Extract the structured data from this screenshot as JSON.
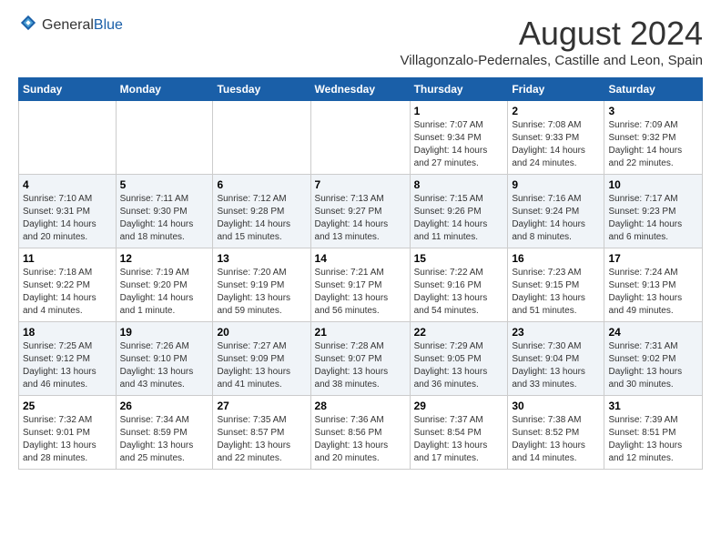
{
  "header": {
    "logo_general": "General",
    "logo_blue": "Blue",
    "month_year": "August 2024",
    "location": "Villagonzalo-Pedernales, Castille and Leon, Spain"
  },
  "weekdays": [
    "Sunday",
    "Monday",
    "Tuesday",
    "Wednesday",
    "Thursday",
    "Friday",
    "Saturday"
  ],
  "weeks": [
    [
      {
        "day": "",
        "sunrise": "",
        "sunset": "",
        "daylight": ""
      },
      {
        "day": "",
        "sunrise": "",
        "sunset": "",
        "daylight": ""
      },
      {
        "day": "",
        "sunrise": "",
        "sunset": "",
        "daylight": ""
      },
      {
        "day": "",
        "sunrise": "",
        "sunset": "",
        "daylight": ""
      },
      {
        "day": "1",
        "sunrise": "Sunrise: 7:07 AM",
        "sunset": "Sunset: 9:34 PM",
        "daylight": "Daylight: 14 hours and 27 minutes."
      },
      {
        "day": "2",
        "sunrise": "Sunrise: 7:08 AM",
        "sunset": "Sunset: 9:33 PM",
        "daylight": "Daylight: 14 hours and 24 minutes."
      },
      {
        "day": "3",
        "sunrise": "Sunrise: 7:09 AM",
        "sunset": "Sunset: 9:32 PM",
        "daylight": "Daylight: 14 hours and 22 minutes."
      }
    ],
    [
      {
        "day": "4",
        "sunrise": "Sunrise: 7:10 AM",
        "sunset": "Sunset: 9:31 PM",
        "daylight": "Daylight: 14 hours and 20 minutes."
      },
      {
        "day": "5",
        "sunrise": "Sunrise: 7:11 AM",
        "sunset": "Sunset: 9:30 PM",
        "daylight": "Daylight: 14 hours and 18 minutes."
      },
      {
        "day": "6",
        "sunrise": "Sunrise: 7:12 AM",
        "sunset": "Sunset: 9:28 PM",
        "daylight": "Daylight: 14 hours and 15 minutes."
      },
      {
        "day": "7",
        "sunrise": "Sunrise: 7:13 AM",
        "sunset": "Sunset: 9:27 PM",
        "daylight": "Daylight: 14 hours and 13 minutes."
      },
      {
        "day": "8",
        "sunrise": "Sunrise: 7:15 AM",
        "sunset": "Sunset: 9:26 PM",
        "daylight": "Daylight: 14 hours and 11 minutes."
      },
      {
        "day": "9",
        "sunrise": "Sunrise: 7:16 AM",
        "sunset": "Sunset: 9:24 PM",
        "daylight": "Daylight: 14 hours and 8 minutes."
      },
      {
        "day": "10",
        "sunrise": "Sunrise: 7:17 AM",
        "sunset": "Sunset: 9:23 PM",
        "daylight": "Daylight: 14 hours and 6 minutes."
      }
    ],
    [
      {
        "day": "11",
        "sunrise": "Sunrise: 7:18 AM",
        "sunset": "Sunset: 9:22 PM",
        "daylight": "Daylight: 14 hours and 4 minutes."
      },
      {
        "day": "12",
        "sunrise": "Sunrise: 7:19 AM",
        "sunset": "Sunset: 9:20 PM",
        "daylight": "Daylight: 14 hours and 1 minute."
      },
      {
        "day": "13",
        "sunrise": "Sunrise: 7:20 AM",
        "sunset": "Sunset: 9:19 PM",
        "daylight": "Daylight: 13 hours and 59 minutes."
      },
      {
        "day": "14",
        "sunrise": "Sunrise: 7:21 AM",
        "sunset": "Sunset: 9:17 PM",
        "daylight": "Daylight: 13 hours and 56 minutes."
      },
      {
        "day": "15",
        "sunrise": "Sunrise: 7:22 AM",
        "sunset": "Sunset: 9:16 PM",
        "daylight": "Daylight: 13 hours and 54 minutes."
      },
      {
        "day": "16",
        "sunrise": "Sunrise: 7:23 AM",
        "sunset": "Sunset: 9:15 PM",
        "daylight": "Daylight: 13 hours and 51 minutes."
      },
      {
        "day": "17",
        "sunrise": "Sunrise: 7:24 AM",
        "sunset": "Sunset: 9:13 PM",
        "daylight": "Daylight: 13 hours and 49 minutes."
      }
    ],
    [
      {
        "day": "18",
        "sunrise": "Sunrise: 7:25 AM",
        "sunset": "Sunset: 9:12 PM",
        "daylight": "Daylight: 13 hours and 46 minutes."
      },
      {
        "day": "19",
        "sunrise": "Sunrise: 7:26 AM",
        "sunset": "Sunset: 9:10 PM",
        "daylight": "Daylight: 13 hours and 43 minutes."
      },
      {
        "day": "20",
        "sunrise": "Sunrise: 7:27 AM",
        "sunset": "Sunset: 9:09 PM",
        "daylight": "Daylight: 13 hours and 41 minutes."
      },
      {
        "day": "21",
        "sunrise": "Sunrise: 7:28 AM",
        "sunset": "Sunset: 9:07 PM",
        "daylight": "Daylight: 13 hours and 38 minutes."
      },
      {
        "day": "22",
        "sunrise": "Sunrise: 7:29 AM",
        "sunset": "Sunset: 9:05 PM",
        "daylight": "Daylight: 13 hours and 36 minutes."
      },
      {
        "day": "23",
        "sunrise": "Sunrise: 7:30 AM",
        "sunset": "Sunset: 9:04 PM",
        "daylight": "Daylight: 13 hours and 33 minutes."
      },
      {
        "day": "24",
        "sunrise": "Sunrise: 7:31 AM",
        "sunset": "Sunset: 9:02 PM",
        "daylight": "Daylight: 13 hours and 30 minutes."
      }
    ],
    [
      {
        "day": "25",
        "sunrise": "Sunrise: 7:32 AM",
        "sunset": "Sunset: 9:01 PM",
        "daylight": "Daylight: 13 hours and 28 minutes."
      },
      {
        "day": "26",
        "sunrise": "Sunrise: 7:34 AM",
        "sunset": "Sunset: 8:59 PM",
        "daylight": "Daylight: 13 hours and 25 minutes."
      },
      {
        "day": "27",
        "sunrise": "Sunrise: 7:35 AM",
        "sunset": "Sunset: 8:57 PM",
        "daylight": "Daylight: 13 hours and 22 minutes."
      },
      {
        "day": "28",
        "sunrise": "Sunrise: 7:36 AM",
        "sunset": "Sunset: 8:56 PM",
        "daylight": "Daylight: 13 hours and 20 minutes."
      },
      {
        "day": "29",
        "sunrise": "Sunrise: 7:37 AM",
        "sunset": "Sunset: 8:54 PM",
        "daylight": "Daylight: 13 hours and 17 minutes."
      },
      {
        "day": "30",
        "sunrise": "Sunrise: 7:38 AM",
        "sunset": "Sunset: 8:52 PM",
        "daylight": "Daylight: 13 hours and 14 minutes."
      },
      {
        "day": "31",
        "sunrise": "Sunrise: 7:39 AM",
        "sunset": "Sunset: 8:51 PM",
        "daylight": "Daylight: 13 hours and 12 minutes."
      }
    ]
  ]
}
